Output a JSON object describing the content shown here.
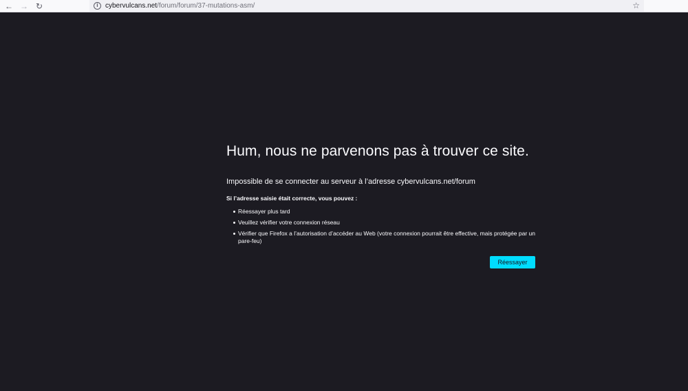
{
  "browser": {
    "back_icon": "arrow-left-icon",
    "forward_icon": "arrow-right-icon",
    "reload_icon": "reload-icon",
    "info_icon": "info-icon",
    "bookmark_icon": "star-icon",
    "url_host": "cybervulcans.net",
    "url_path": "/forum/forum/37-mutations-asm/"
  },
  "error": {
    "title": "Hum, nous ne parvenons pas à trouver ce site.",
    "short_desc": "Impossible de se connecter au serveur à l’adresse cybervulcans.net/forum",
    "long_title": "Si l’adresse saisie était correcte, vous pouvez :",
    "suggestions": [
      "Réessayer plus tard",
      "Veuillez vérifier votre connexion réseau",
      "Vérifier que Firefox a l’autorisation d’accéder au Web (votre connexion pourrait être effective, mais protégée par un pare-feu)"
    ],
    "retry_label": "Réessayer"
  },
  "colors": {
    "page_background": "#1c1b22",
    "text": "#fbfbfe",
    "accent_button": "#00ddff"
  }
}
